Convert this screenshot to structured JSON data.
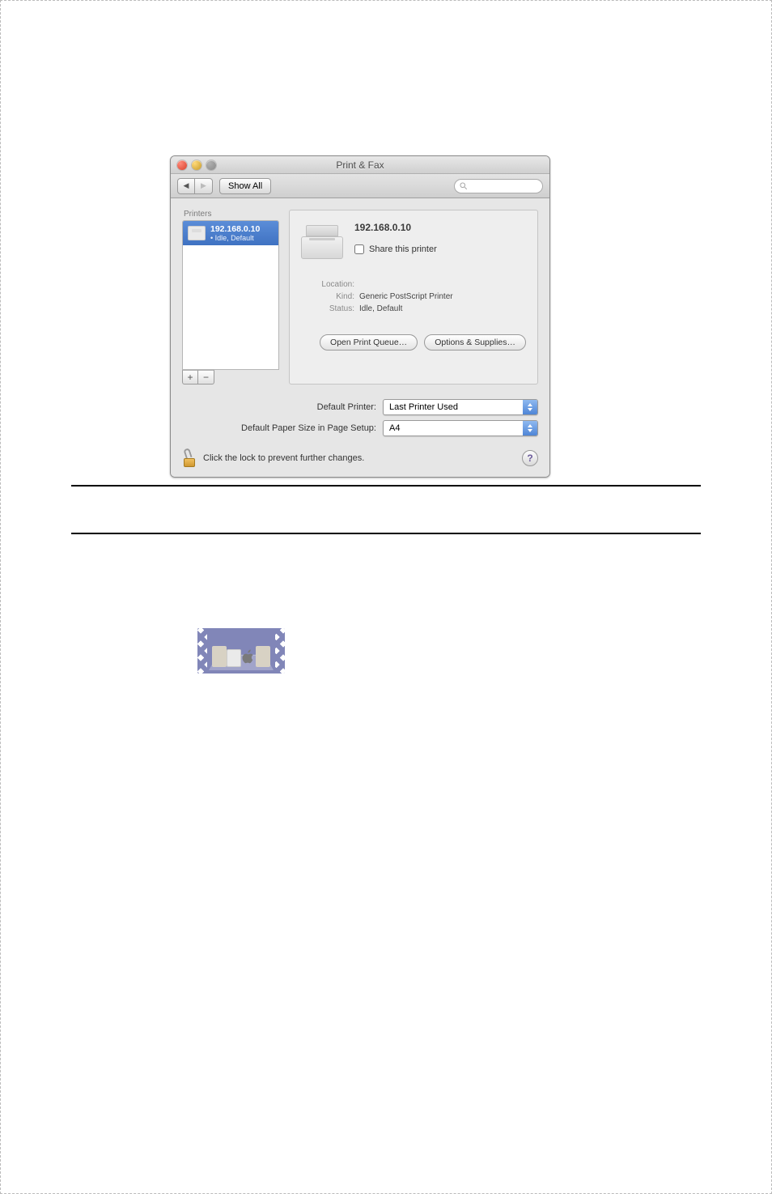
{
  "window": {
    "title": "Print & Fax",
    "toolbar": {
      "show_all_label": "Show All"
    },
    "sidebar": {
      "label": "Printers",
      "items": [
        {
          "name": "192.168.0.10",
          "status": "• Idle, Default"
        }
      ]
    },
    "detail": {
      "name": "192.168.0.10",
      "share_label": "Share this printer",
      "location_label": "Location:",
      "location_value": "",
      "kind_label": "Kind:",
      "kind_value": "Generic PostScript Printer",
      "status_label": "Status:",
      "status_value": "Idle, Default",
      "open_queue_label": "Open Print Queue…",
      "options_label": "Options & Supplies…"
    },
    "dropdowns": {
      "default_printer_label": "Default Printer:",
      "default_printer_value": "Last Printer Used",
      "paper_size_label": "Default Paper Size in Page Setup:",
      "paper_size_value": "A4"
    },
    "footer": {
      "lock_text": "Click the lock to prevent further changes.",
      "help": "?"
    }
  }
}
